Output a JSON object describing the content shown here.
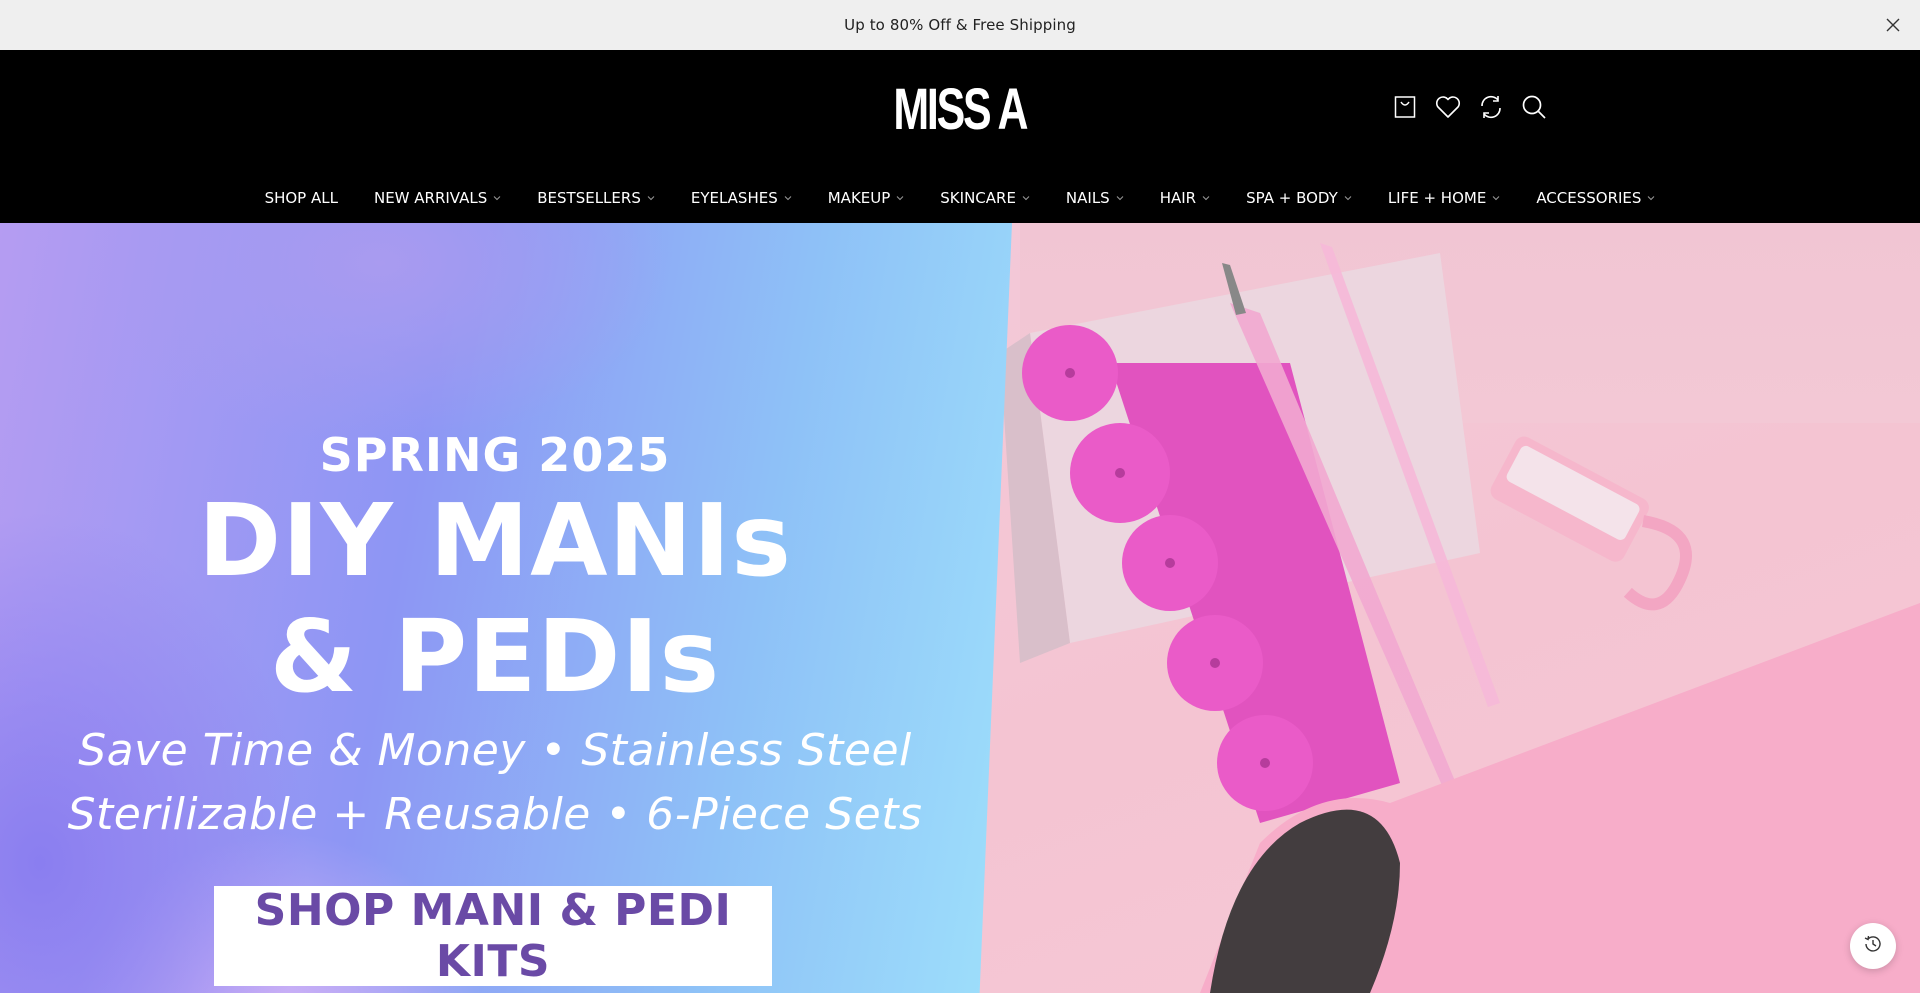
{
  "announcement": {
    "text": "Up to 80% Off & Free Shipping",
    "close_icon": "close-icon"
  },
  "header": {
    "logo_text": "MISS A",
    "icons": [
      "cart-icon",
      "wishlist-heart-icon",
      "compare-refresh-icon",
      "search-icon"
    ]
  },
  "nav": {
    "items": [
      {
        "label": "SHOP ALL",
        "has_dropdown": false
      },
      {
        "label": "NEW ARRIVALS",
        "has_dropdown": true
      },
      {
        "label": "BESTSELLERS",
        "has_dropdown": true
      },
      {
        "label": "EYELASHES",
        "has_dropdown": true
      },
      {
        "label": "MAKEUP",
        "has_dropdown": true
      },
      {
        "label": "SKINCARE",
        "has_dropdown": true
      },
      {
        "label": "NAILS",
        "has_dropdown": true
      },
      {
        "label": "HAIR",
        "has_dropdown": true
      },
      {
        "label": "SPA + BODY",
        "has_dropdown": true
      },
      {
        "label": "LIFE + HOME",
        "has_dropdown": true
      },
      {
        "label": "ACCESSORIES",
        "has_dropdown": true
      }
    ]
  },
  "hero": {
    "season": "SPRING 2025",
    "title_line1": "DIY MANIs",
    "title_line2": "& PEDIs",
    "subtitle_line1": "Save Time & Money • Stainless Steel",
    "subtitle_line2": "Sterilizable + Reusable • 6-Piece Sets",
    "cta_label": "SHOP MANI & PEDI KITS"
  },
  "floating": {
    "recently_viewed_icon": "history-clock-icon"
  },
  "colors": {
    "announcement_bg": "#efefef",
    "header_bg": "#000000",
    "cta_text": "#6a4aa6",
    "hero_pink": "#f4c4d2"
  }
}
